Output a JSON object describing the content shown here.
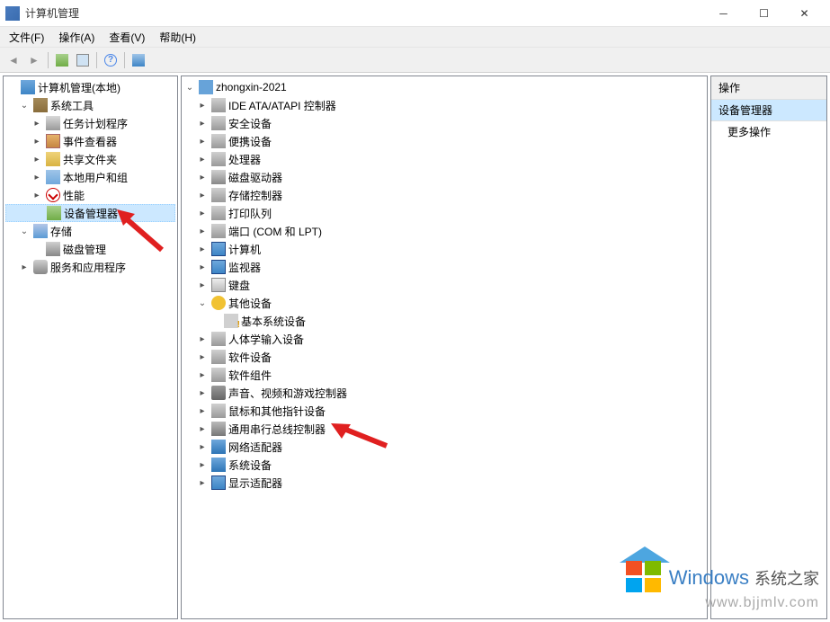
{
  "title": "计算机管理",
  "menus": {
    "file": "文件(F)",
    "action": "操作(A)",
    "view": "查看(V)",
    "help": "帮助(H)"
  },
  "left_tree": {
    "root": "计算机管理(本地)",
    "sys_tools": "系统工具",
    "task_sched": "任务计划程序",
    "event_viewer": "事件查看器",
    "shared": "共享文件夹",
    "users": "本地用户和组",
    "perf": "性能",
    "dev_mgr": "设备管理器",
    "storage": "存储",
    "disk_mgmt": "磁盘管理",
    "services": "服务和应用程序"
  },
  "device_tree": {
    "root": "zhongxin-2021",
    "ide": "IDE ATA/ATAPI 控制器",
    "security": "安全设备",
    "portable": "便携设备",
    "cpu": "处理器",
    "diskdrive": "磁盘驱动器",
    "storage_ctrl": "存储控制器",
    "print_queue": "打印队列",
    "ports": "端口 (COM 和 LPT)",
    "computer": "计算机",
    "monitor": "监视器",
    "keyboard": "键盘",
    "other": "其他设备",
    "unknown": "基本系统设备",
    "hid": "人体学输入设备",
    "soft_dev": "软件设备",
    "soft_comp": "软件组件",
    "sound": "声音、视频和游戏控制器",
    "mouse": "鼠标和其他指针设备",
    "usb": "通用串行总线控制器",
    "network": "网络适配器",
    "system": "系统设备",
    "display": "显示适配器"
  },
  "actions": {
    "header": "操作",
    "selected": "设备管理器",
    "more": "更多操作"
  },
  "watermark": {
    "brand": "Windows",
    "sub": "系统之家",
    "url": "www.bjjmlv.com"
  }
}
